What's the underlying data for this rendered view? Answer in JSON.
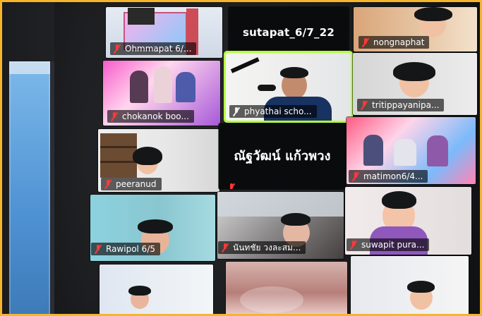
{
  "tiles": [
    {
      "id": "ohmmapat",
      "label": "Ohmmapat 6/...",
      "bg": "#e5ebf3"
    },
    {
      "id": "sutapat",
      "label": "sutapat_6/7_22",
      "bg": "#0b0c0e"
    },
    {
      "id": "nongnaphat",
      "label": "nongnaphat",
      "bg": "#d7a57a"
    },
    {
      "id": "chokanok",
      "label": "chokanok boo...",
      "bg": "#f15ec7"
    },
    {
      "id": "phyathai",
      "label": "phyathai scho...",
      "bg": "#f3f4f3"
    },
    {
      "id": "tritippayanipa",
      "label": "tritippayanipa...",
      "bg": "#d8d8d8"
    },
    {
      "id": "peeranud",
      "label": "peeranud",
      "bg": "#efefef"
    },
    {
      "id": "thai_name",
      "label": "ณัฐวัฒน์ แก้วพวง",
      "bg": "#0b0c0e"
    },
    {
      "id": "matimon",
      "label": "matimon6/4...",
      "bg": "#ff5c83"
    },
    {
      "id": "rawipol",
      "label": "Rawipol 6/5",
      "bg": "#8fd1de"
    },
    {
      "id": "nontachai",
      "label": "นันทชัย วงละสม...",
      "bg": "#a9a0a0"
    },
    {
      "id": "suwapit",
      "label": "suwapit pura...",
      "bg": "#efe9e8"
    },
    {
      "id": "bottom_left",
      "label": "",
      "bg": "#dfe6f0"
    },
    {
      "id": "bottom_mid",
      "label": "",
      "bg": "#c9a3a0"
    },
    {
      "id": "bottom_right",
      "label": "",
      "bg": "#e7e9ee"
    }
  ],
  "colors": {
    "frame": "#f6b52a",
    "selected_border": "#b8ff47",
    "muted_icon": "#ff3a3a"
  }
}
